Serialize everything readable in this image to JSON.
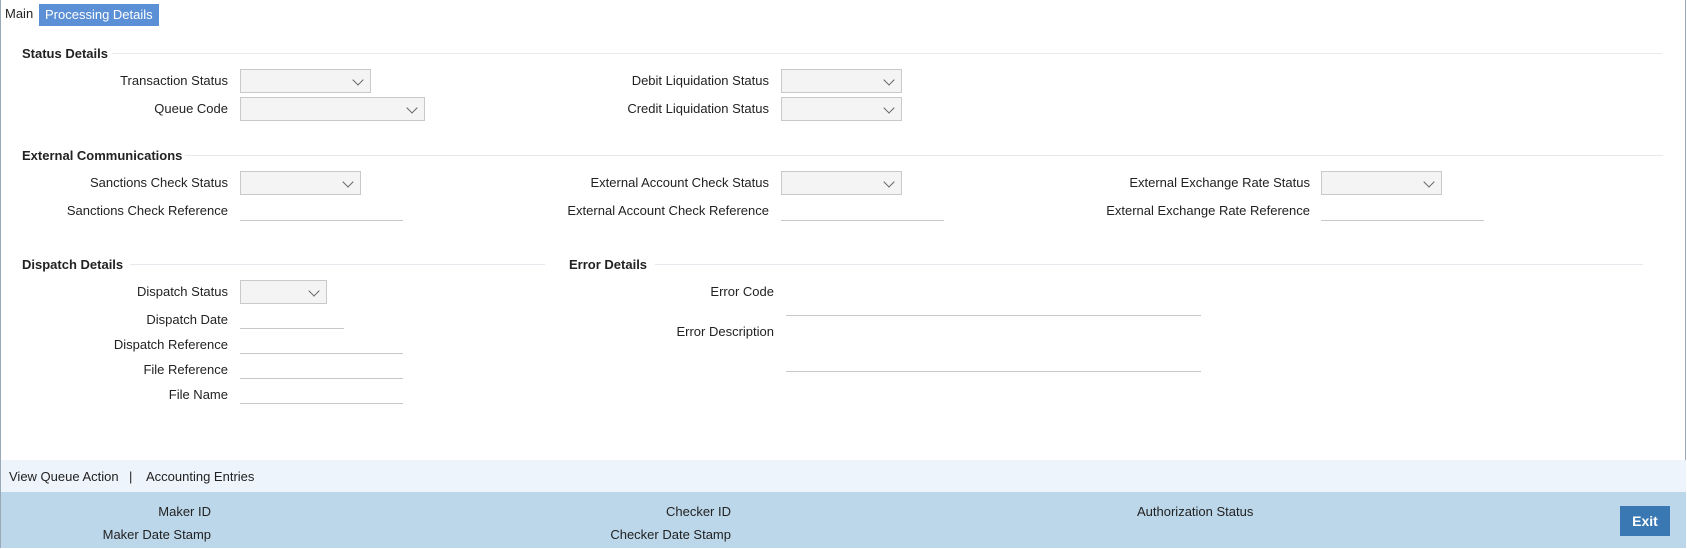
{
  "tabs": {
    "main": "Main",
    "processing": "Processing Details"
  },
  "status_details": {
    "title": "Status Details",
    "transaction_status": "Transaction Status",
    "queue_code": "Queue Code",
    "debit_liquidation_status": "Debit Liquidation Status",
    "credit_liquidation_status": "Credit Liquidation Status"
  },
  "external": {
    "title": "External Communications",
    "sanctions_check_status": "Sanctions Check Status",
    "sanctions_check_reference": "Sanctions Check Reference",
    "external_account_check_status": "External Account Check Status",
    "external_account_check_reference": "External Account Check Reference",
    "external_exchange_rate_status": "External Exchange Rate Status",
    "external_exchange_rate_reference": "External Exchange Rate Reference"
  },
  "dispatch": {
    "title": "Dispatch Details",
    "dispatch_status": "Dispatch Status",
    "dispatch_date": "Dispatch Date",
    "dispatch_reference": "Dispatch Reference",
    "file_reference": "File Reference",
    "file_name": "File Name"
  },
  "error": {
    "title": "Error Details",
    "error_code": "Error Code",
    "error_description": "Error Description"
  },
  "actions": {
    "view_queue_action": "View Queue Action",
    "separator": "|",
    "accounting_entries": "Accounting Entries"
  },
  "footer": {
    "maker_id": "Maker ID",
    "maker_date_stamp": "Maker Date Stamp",
    "checker_id": "Checker ID",
    "checker_date_stamp": "Checker Date Stamp",
    "authorization_status": "Authorization Status",
    "exit": "Exit"
  },
  "icons": {
    "dropdown": "chevron-down-icon"
  },
  "colors": {
    "tab_active": "#5b8fd6",
    "footer_bg": "#bcd7ea",
    "actionbar_bg": "#eef4fb",
    "exit_button": "#3a78b3"
  }
}
